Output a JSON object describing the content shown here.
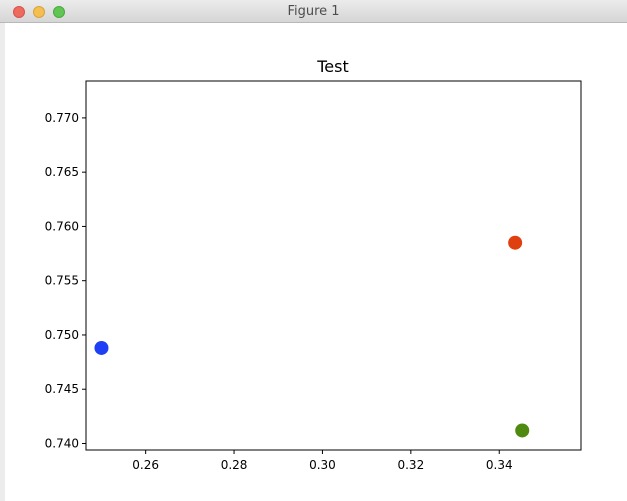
{
  "window": {
    "title": "Figure 1"
  },
  "chart_data": {
    "type": "scatter",
    "title": "Test",
    "xlabel": "",
    "ylabel": "",
    "xlim": [
      0.2465,
      0.3585
    ],
    "ylim": [
      0.7394,
      0.7734
    ],
    "x_ticks": [
      0.26,
      0.28,
      0.3,
      0.32,
      0.34
    ],
    "x_tick_labels": [
      "0.26",
      "0.28",
      "0.30",
      "0.32",
      "0.34"
    ],
    "y_ticks": [
      0.74,
      0.745,
      0.75,
      0.755,
      0.76,
      0.765,
      0.77
    ],
    "y_tick_labels": [
      "0.740",
      "0.745",
      "0.750",
      "0.755",
      "0.760",
      "0.765",
      "0.770"
    ],
    "grid": false,
    "points": [
      {
        "x": 0.25,
        "y": 0.7488,
        "color": "#1f3ff5"
      },
      {
        "x": 0.3436,
        "y": 0.7585,
        "color": "#e0400f"
      },
      {
        "x": 0.3452,
        "y": 0.7412,
        "color": "#4f8a10"
      }
    ]
  }
}
